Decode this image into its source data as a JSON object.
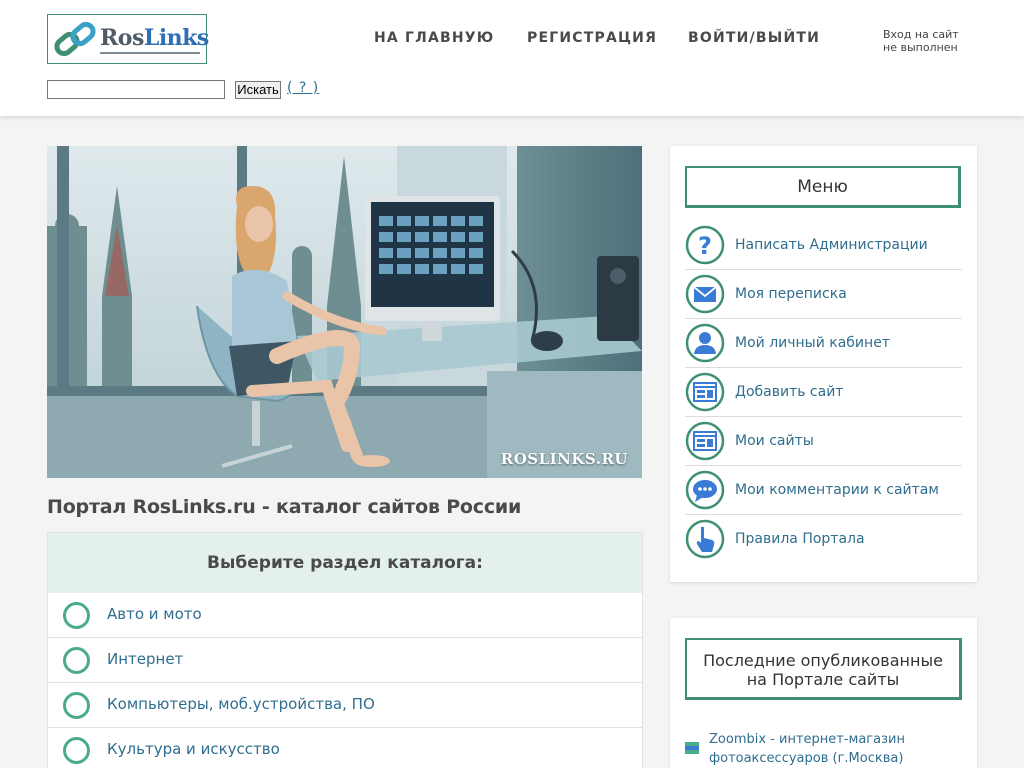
{
  "header": {
    "logo": {
      "ros": "Ros",
      "links": "Links"
    },
    "nav": {
      "home": "НА ГЛАВНУЮ",
      "register": "РЕГИСТРАЦИЯ",
      "login": "ВОЙТИ/ВЫЙТИ"
    },
    "login_status": {
      "line1": "Вход на сайт",
      "line2": "не выполнен"
    },
    "search": {
      "value": "",
      "button_label": "Искать",
      "help_label": "( ? )"
    }
  },
  "hero": {
    "watermark": "ROSLINKS.RU"
  },
  "main": {
    "page_title": "Портал RosLinks.ru - каталог сайтов России",
    "catalog": {
      "heading": "Выберите раздел каталога:",
      "items": [
        "Авто и мото",
        "Интернет",
        "Компьютеры, моб.устройства, ПО",
        "Культура и искусство"
      ]
    }
  },
  "sidebar": {
    "menu": {
      "title": "Меню",
      "items": [
        {
          "label": "Написать Администрации",
          "icon": "question-icon"
        },
        {
          "label": "Моя переписка",
          "icon": "envelope-icon"
        },
        {
          "label": "Мой личный кабинет",
          "icon": "user-icon"
        },
        {
          "label": "Добавить сайт",
          "icon": "browser-window-icon"
        },
        {
          "label": "Мои сайты",
          "icon": "browser-window-icon"
        },
        {
          "label": "Мои комментарии к сайтам",
          "icon": "chat-bubble-icon"
        },
        {
          "label": "Правила Портала",
          "icon": "pointer-hand-icon"
        }
      ]
    },
    "latest": {
      "title_line1": "Последние опубликованные",
      "title_line2": "на Портале сайты",
      "items": [
        {
          "text": "Zoombix - интернет-магазин фотоаксессуаров (г.Москва)"
        }
      ]
    }
  },
  "colors": {
    "accent": "#3e8f73",
    "link": "#2f6e8f",
    "catalog_head": "#e3f1ea",
    "icon_blue": "#3a7bd5"
  }
}
